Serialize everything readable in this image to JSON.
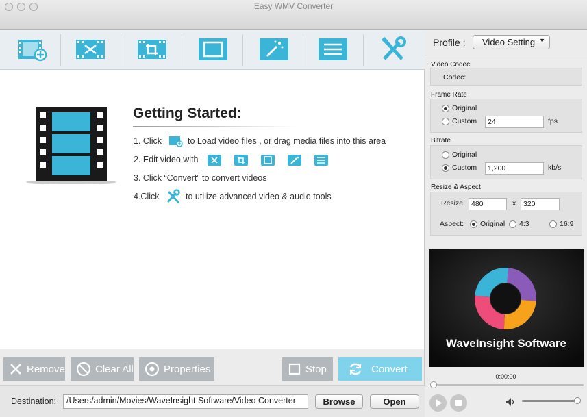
{
  "window": {
    "title": "Easy WMV Converter"
  },
  "toolbar": {
    "icons": [
      "add-video-icon",
      "trim-icon",
      "crop-icon",
      "border-icon",
      "effect-icon",
      "watermark-icon",
      "tools-icon"
    ]
  },
  "getting_started": {
    "title": "Getting Started:",
    "step1_pre": "1. Click",
    "step1_post": "to Load video files , or drag media files into this area",
    "step2": "2. Edit video with",
    "step3": "3. Click “Convert” to convert videos",
    "step4_pre": "4.Click",
    "step4_post": "to utilize advanced video & audio tools"
  },
  "actions": {
    "remove": "Remove",
    "clear_all": "Clear All",
    "properties": "Properties",
    "stop": "Stop",
    "convert": "Convert"
  },
  "destination": {
    "label": "Destination:",
    "path": "/Users/admin/Movies/WaveInsight Software/Video Converter",
    "browse": "Browse",
    "open": "Open"
  },
  "profile": {
    "label": "Profile :",
    "value": "Video Setting"
  },
  "video_codec": {
    "header": "Video Codec",
    "codec_label": "Codec:"
  },
  "frame_rate": {
    "header": "Frame Rate",
    "original": "Original",
    "custom": "Custom",
    "value": "24",
    "unit": "fps"
  },
  "bitrate": {
    "header": "Bitrate",
    "original": "Original",
    "custom": "Custom",
    "value": "1,200",
    "unit": "kb/s"
  },
  "resize": {
    "header": "Resize & Aspect",
    "resize_label": "Resize:",
    "width": "480",
    "x": "x",
    "height": "320",
    "aspect_label": "Aspect:",
    "aspect_original": "Original",
    "aspect_43": "4:3",
    "aspect_169": "16:9"
  },
  "preview": {
    "brand": "WaveInsight Software"
  },
  "player": {
    "time": "0:00:00",
    "progress": 0,
    "volume": 1.0
  },
  "colors": {
    "accent": "#3ab5d8",
    "button_gray": "#b2b8bb",
    "convert": "#7fd3ea"
  }
}
